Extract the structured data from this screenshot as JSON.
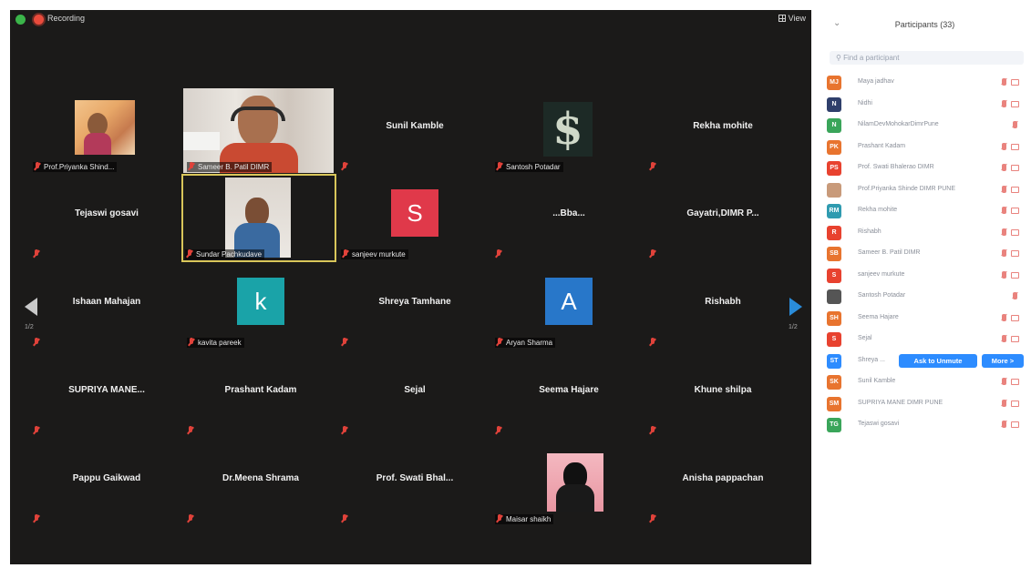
{
  "top_bar": {
    "recording_label": "Recording",
    "view_label": "View"
  },
  "tiles": [
    {
      "name": "Prof.Priyanka Shind..."
    },
    {
      "name": "Sameer B. Patil DIMR"
    },
    {
      "name": "Sunil Kamble"
    },
    {
      "name": "Santosh Potadar"
    },
    {
      "name": "Rekha mohite"
    },
    {
      "name": "Tejaswi gosavi"
    },
    {
      "name": "Sundar Pachkudave"
    },
    {
      "name": "sanjeev murkute",
      "initial": "S"
    },
    {
      "name": "...Bba..."
    },
    {
      "name": "Gayatri,DIMR P..."
    },
    {
      "name": "Ishaan Mahajan"
    },
    {
      "name": "kavita pareek",
      "initial": "k"
    },
    {
      "name": "Shreya Tamhane"
    },
    {
      "name": "Aryan Sharma",
      "initial": "A"
    },
    {
      "name": "Rishabh"
    },
    {
      "name": "SUPRIYA MANE..."
    },
    {
      "name": "Prashant Kadam"
    },
    {
      "name": "Sejal"
    },
    {
      "name": "Seema Hajare"
    },
    {
      "name": "Khune shilpa"
    },
    {
      "name": "Pappu Gaikwad"
    },
    {
      "name": "Dr.Meena Shrama"
    },
    {
      "name": "Prof. Swati Bhal..."
    },
    {
      "name": "Maisar shaikh"
    },
    {
      "name": "Anisha pappachan"
    }
  ],
  "pager": {
    "left": "1/2",
    "right": "1/2"
  },
  "panel": {
    "title": "Participants (33)",
    "search_placeholder": "Find a participant",
    "participants": [
      {
        "initials": "MJ",
        "name": "Maya jadhav",
        "color": "#e8742f"
      },
      {
        "initials": "N",
        "name": "Nidhi",
        "color": "#2f3f6b"
      },
      {
        "initials": "N",
        "name": "NilamDevMohokarDimrPune",
        "color": "#3aa55a"
      },
      {
        "initials": "PK",
        "name": "Prashant Kadam",
        "color": "#e8742f"
      },
      {
        "initials": "PS",
        "name": "Prof. Swati Bhalerao DIMR",
        "color": "#e8422f"
      },
      {
        "initials": "",
        "name": "Prof.Priyanka Shinde DIMR PUNE",
        "color": "#c89a7a"
      },
      {
        "initials": "RM",
        "name": "Rekha mohite",
        "color": "#2f9bb0"
      },
      {
        "initials": "R",
        "name": "Rishabh",
        "color": "#e8422f"
      },
      {
        "initials": "SB",
        "name": "Sameer B. Patil DIMR",
        "color": "#e8742f"
      },
      {
        "initials": "S",
        "name": "sanjeev murkute",
        "color": "#e8422f"
      },
      {
        "initials": "",
        "name": "Santosh Potadar",
        "color": "#555"
      },
      {
        "initials": "SH",
        "name": "Seema Hajare",
        "color": "#e8742f"
      },
      {
        "initials": "S",
        "name": "Sejal",
        "color": "#e8422f"
      },
      {
        "initials": "ST",
        "name": "Shreya ...",
        "color": "#2d8cff"
      },
      {
        "initials": "SK",
        "name": "Sunil Kamble",
        "color": "#e8742f"
      },
      {
        "initials": "SM",
        "name": "SUPRIYA MANE DIMR PUNE",
        "color": "#e8742f"
      },
      {
        "initials": "TG",
        "name": "Tejaswi gosavi",
        "color": "#3aa55a"
      }
    ],
    "ask_to_unmute": "Ask to Unmute",
    "more": "More >"
  }
}
